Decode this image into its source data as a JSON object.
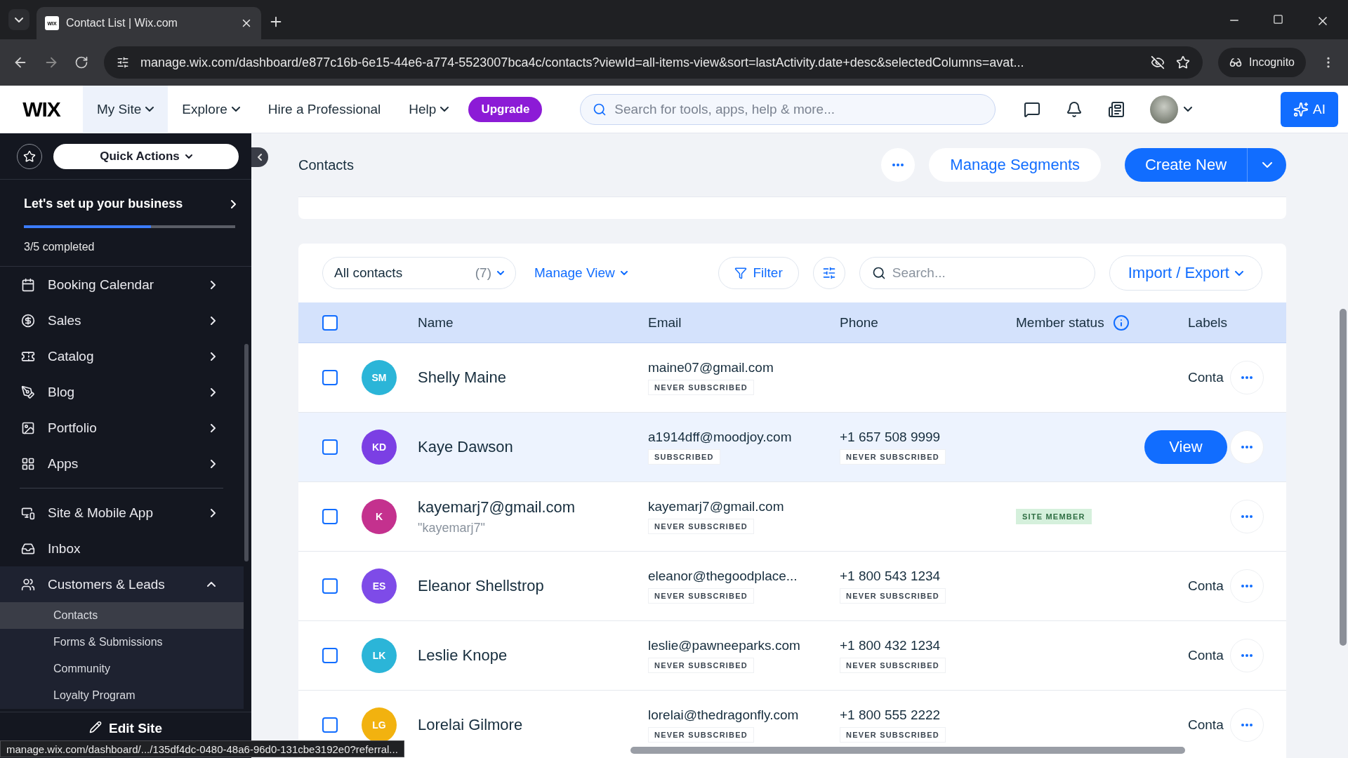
{
  "browser": {
    "tab_logo": "WIX",
    "tab_title": "Contact List | Wix.com",
    "url": "manage.wix.com/dashboard/e877c16b-6e15-44e6-a774-5523007bca4c/contacts?viewId=all-items-view&sort=lastActivity.date+desc&selectedColumns=avat...",
    "profile": "Incognito"
  },
  "topbar": {
    "logo": "WIX",
    "nav": [
      {
        "label": "My Site",
        "dropdown": true,
        "selected": true
      },
      {
        "label": "Explore",
        "dropdown": true,
        "selected": false
      },
      {
        "label": "Hire a Professional",
        "dropdown": false,
        "selected": false
      },
      {
        "label": "Help",
        "dropdown": true,
        "selected": false
      }
    ],
    "upgrade": "Upgrade",
    "search": {
      "placeholder": "Search for tools, apps, help & more..."
    },
    "ai_button": "AI"
  },
  "sidebar": {
    "quick_actions": "Quick Actions",
    "setup": {
      "title": "Let's set up your business",
      "level": 0.6,
      "progress": "3/5 completed"
    },
    "groups": [
      {
        "items": [
          {
            "kind": "submenu",
            "label": "Booking Calendar"
          },
          {
            "kind": "submenu",
            "label": "Sales"
          },
          {
            "kind": "submenu",
            "label": "Catalog"
          },
          {
            "kind": "submenu",
            "label": "Blog"
          },
          {
            "kind": "submenu",
            "label": "Portfolio"
          },
          {
            "kind": "submenu",
            "label": "Apps"
          }
        ]
      },
      {
        "items": [
          {
            "kind": "submenu",
            "label": "Site & Mobile App"
          },
          {
            "kind": "link",
            "label": "Inbox"
          },
          {
            "kind": "group",
            "label": "Customers & Leads",
            "expanded": true,
            "children": [
              {
                "label": "Contacts",
                "selected": true
              },
              {
                "label": "Forms & Submissions",
                "selected": false
              },
              {
                "label": "Community",
                "selected": false
              },
              {
                "label": "Loyalty Program",
                "selected": false
              }
            ]
          }
        ]
      }
    ],
    "edit_site": "Edit Site"
  },
  "page": {
    "title": "Contacts",
    "manage_segments": "Manage Segments",
    "create_new": "Create New",
    "toolbar": {
      "view": "All contacts",
      "count": "(7)",
      "manage_view": "Manage View",
      "filter": "Filter",
      "search": {
        "placeholder": "Search..."
      },
      "import_export": "Import / Export"
    },
    "table": {
      "all_checked": false,
      "columns": [
        {
          "label": "Name"
        },
        {
          "label": "Email"
        },
        {
          "label": "Phone"
        },
        {
          "label": "Member status",
          "info": true
        },
        {
          "label": "Labels"
        }
      ],
      "rows": [
        {
          "initials": "SM",
          "color": "#2bb5d8",
          "name": "Shelly Maine",
          "email": "maine07@gmail.com",
          "email_status": "NEVER SUBSCRIBED",
          "label": "Conta",
          "checked": false,
          "hovered": false
        },
        {
          "initials": "KD",
          "color": "#7b3fe4",
          "name": "Kaye Dawson",
          "email": "a1914dff@moodjoy.com",
          "email_status": "SUBSCRIBED",
          "phone": "+1 657 508 9999",
          "phone_status": "NEVER SUBSCRIBED",
          "action": "View",
          "checked": false,
          "hovered": true
        },
        {
          "initials": "K",
          "color": "#c4318e",
          "name": "kayemarj7@gmail.com",
          "nickname": "\"kayemarj7\"",
          "email": "kayemarj7@gmail.com",
          "email_status": "NEVER SUBSCRIBED",
          "member_status": "SITE MEMBER",
          "checked": false,
          "hovered": false
        },
        {
          "initials": "ES",
          "color": "#7e4be8",
          "name": "Eleanor Shellstrop",
          "email": "eleanor@thegoodplace...",
          "email_status": "NEVER SUBSCRIBED",
          "phone": "+1 800 543 1234",
          "phone_status": "NEVER SUBSCRIBED",
          "label": "Conta",
          "checked": false,
          "hovered": false
        },
        {
          "initials": "LK",
          "color": "#2bb5d8",
          "name": "Leslie Knope",
          "email": "leslie@pawneeparks.com",
          "email_status": "NEVER SUBSCRIBED",
          "phone": "+1 800 432 1234",
          "phone_status": "NEVER SUBSCRIBED",
          "label": "Conta",
          "checked": false,
          "hovered": false
        },
        {
          "initials": "LG",
          "color": "#f2b20f",
          "name": "Lorelai Gilmore",
          "email": "lorelai@thedragonfly.com",
          "email_status": "NEVER SUBSCRIBED",
          "phone": "+1 800 555 2222",
          "phone_status": "NEVER SUBSCRIBED",
          "label": "Conta",
          "checked": false,
          "hovered": false
        }
      ]
    }
  },
  "status_url": "manage.wix.com/dashboard/.../135df4dc-0480-48a6-96d0-131cbe3192e0?referral..."
}
